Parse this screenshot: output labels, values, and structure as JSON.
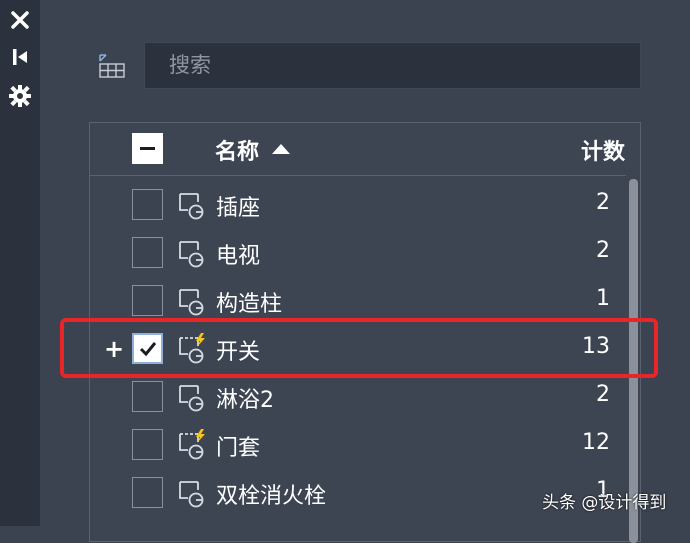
{
  "toolstrip": {
    "icons": [
      "close-icon",
      "pin-panel-icon",
      "settings-icon"
    ]
  },
  "search": {
    "placeholder": "搜索"
  },
  "table": {
    "columns": {
      "name": "名称",
      "count": "计数"
    },
    "sort": "ascending",
    "rows": [
      {
        "name": "插座",
        "count": "2",
        "checked": false,
        "dynamic": false
      },
      {
        "name": "电视",
        "count": "2",
        "checked": false,
        "dynamic": false
      },
      {
        "name": "构造柱",
        "count": "1",
        "checked": false,
        "dynamic": false
      },
      {
        "name": "开关",
        "count": "13",
        "checked": true,
        "dynamic": true,
        "expand": "+"
      },
      {
        "name": "淋浴2",
        "count": "2",
        "checked": false,
        "dynamic": false
      },
      {
        "name": "门套",
        "count": "12",
        "checked": false,
        "dynamic": true
      },
      {
        "name": "双栓消火栓",
        "count": "1",
        "checked": false,
        "dynamic": false
      }
    ]
  },
  "highlight_color": "#e8262a",
  "watermark": "头条 @设计得到"
}
